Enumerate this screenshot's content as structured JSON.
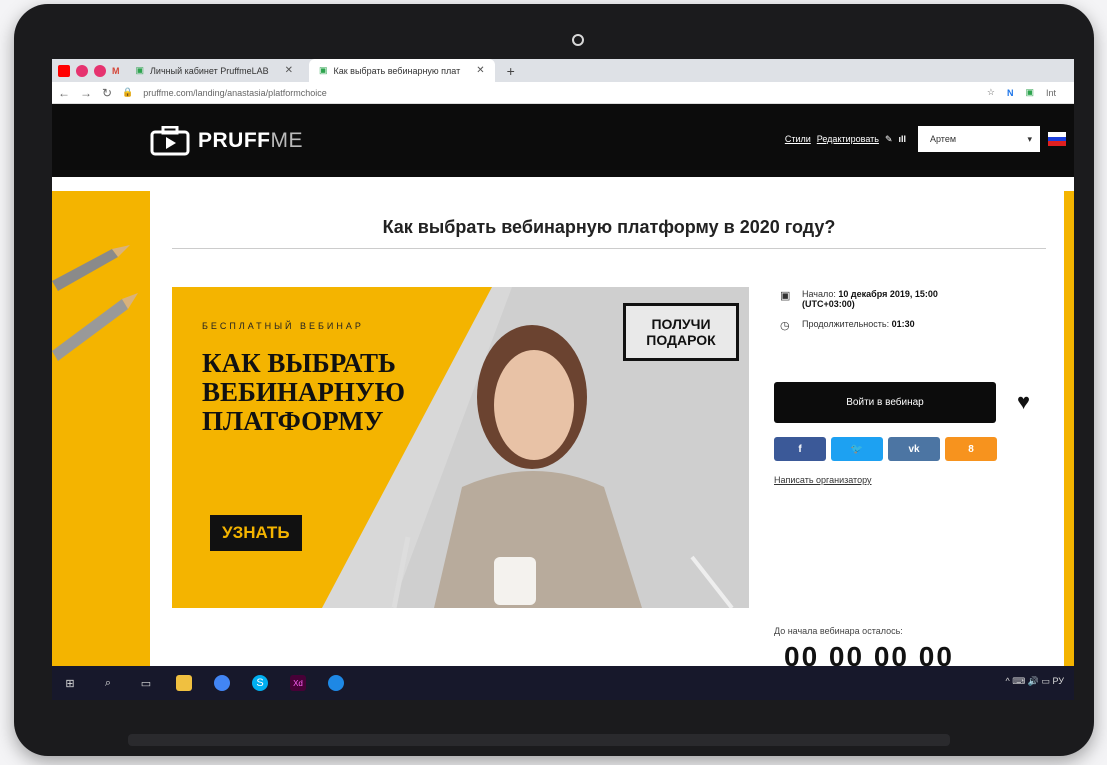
{
  "browser": {
    "tabs": [
      {
        "label": "Личный кабинет PruffmeLAB",
        "active": false
      },
      {
        "label": "Как выбрать вебинарную плат",
        "active": true
      }
    ],
    "gmail_glyph": "M",
    "new_tab_glyph": "+",
    "close_glyph": "✕",
    "url": "pruffme.com/landing/anastasia/platformchoice",
    "extension_text": "Int"
  },
  "site": {
    "logo_bold": "PRUFF",
    "logo_light": "ME",
    "header_links": {
      "styles": "Стили",
      "edit": "Редактировать"
    },
    "user_select": "Артем"
  },
  "page": {
    "title": "Как выбрать вебинарную платформу в 2020 году?",
    "banner": {
      "kicker": "БЕСПЛАТНЫЙ ВЕБИНАР",
      "heading": "КАК ВЫБРАТЬ ВЕБИНАРНУЮ ПЛАТФОРМУ",
      "button": "УЗНАТЬ",
      "gift_line1": "ПОЛУЧИ",
      "gift_line2": "ПОДАРОК"
    },
    "info": {
      "start_label": "Начало:",
      "start_value": "10 декабря 2019, 15:00",
      "start_tz": "(UTC+03:00)",
      "duration_label": "Продолжительность:",
      "duration_value": "01:30"
    },
    "join_button": "Войти в вебинар",
    "social": [
      {
        "label": "f",
        "color": "#3b5998"
      },
      {
        "label": "🐦",
        "color": "#1da1f2"
      },
      {
        "label": "vk",
        "color": "#4c75a3"
      },
      {
        "label": "8",
        "color": "#f7931e"
      }
    ],
    "write_organizer": "Написать организатору",
    "countdown_label": "До начала вебинара осталось:",
    "countdown_value": "00 00 00 00"
  },
  "taskbar": {
    "tray_text": "^ ⌨ 🔊 ▭ РУ"
  },
  "colors": {
    "accent_yellow": "#f4b400",
    "header_black": "#0c0c0c"
  }
}
